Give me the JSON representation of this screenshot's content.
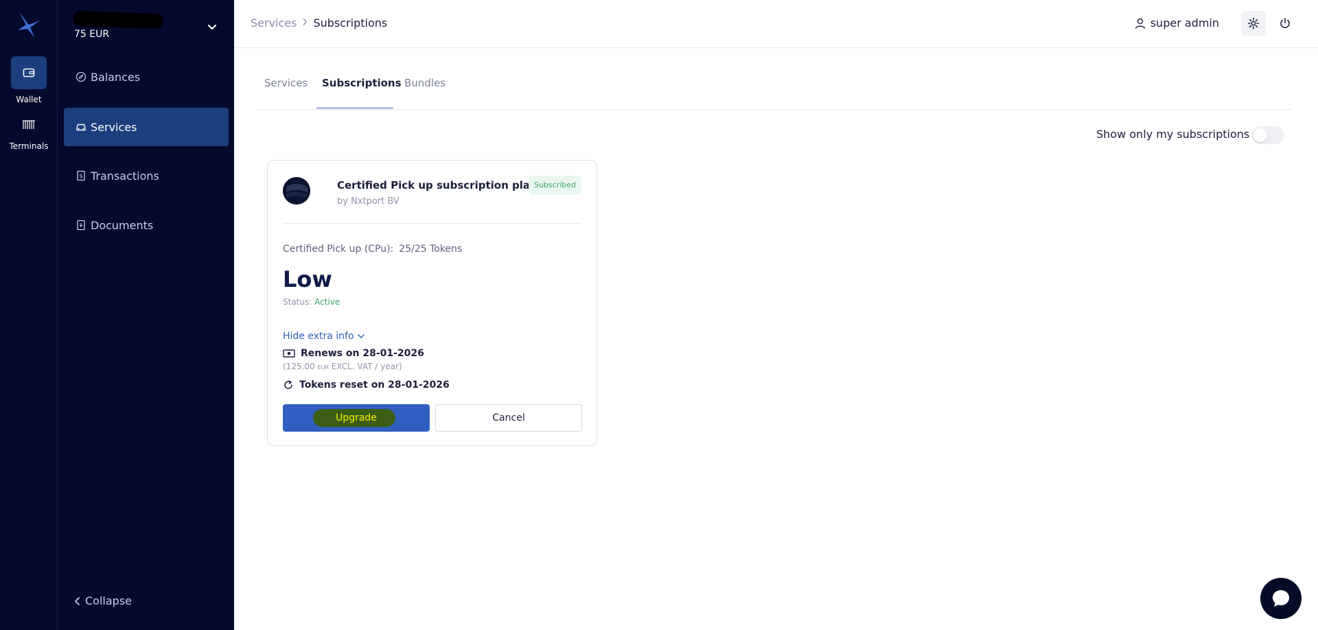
{
  "rail": {
    "items": [
      {
        "label": "Wallet",
        "icon": "wallet-icon"
      },
      {
        "label": "Terminals",
        "icon": "barcode-icon"
      }
    ]
  },
  "account": {
    "balance": "75 EUR"
  },
  "sidebar": {
    "items": [
      {
        "label": "Balances",
        "icon": "compass-icon"
      },
      {
        "label": "Services",
        "icon": "car-icon"
      },
      {
        "label": "Transactions",
        "icon": "receipt-icon"
      },
      {
        "label": "Documents",
        "icon": "document-icon"
      }
    ],
    "collapse_label": "Collapse"
  },
  "header": {
    "breadcrumb_root": "Services",
    "breadcrumb_current": "Subscriptions",
    "user_name": "super admin"
  },
  "tabs": [
    {
      "label": "Services"
    },
    {
      "label": "Subscriptions"
    },
    {
      "label": "Bundles"
    }
  ],
  "filter": {
    "label": "Show only my subscriptions",
    "on": false
  },
  "card": {
    "title": "Certified Pick up subscription plans",
    "provider": "by Nxtport BV",
    "badge": "Subscribed",
    "service_label": "Certified Pick up (CPu):",
    "tokens": "25/25 Tokens",
    "plan": "Low",
    "status_label": "Status:",
    "status_value": "Active",
    "toggle_info": "Hide extra info",
    "renews": "Renews on 28-01-2026",
    "price_open": "(125.00",
    "price_currency": "EUR",
    "price_rest": "EXCL. VAT / year)",
    "tokens_reset": "Tokens reset on 28-01-2026",
    "upgrade_label": "Upgrade",
    "cancel_label": "Cancel"
  },
  "colors": {
    "sidebar_bg": "#050a2d",
    "active_bg": "#1c3d7e",
    "primary": "#2f5fc0",
    "success": "#3aa46a"
  }
}
